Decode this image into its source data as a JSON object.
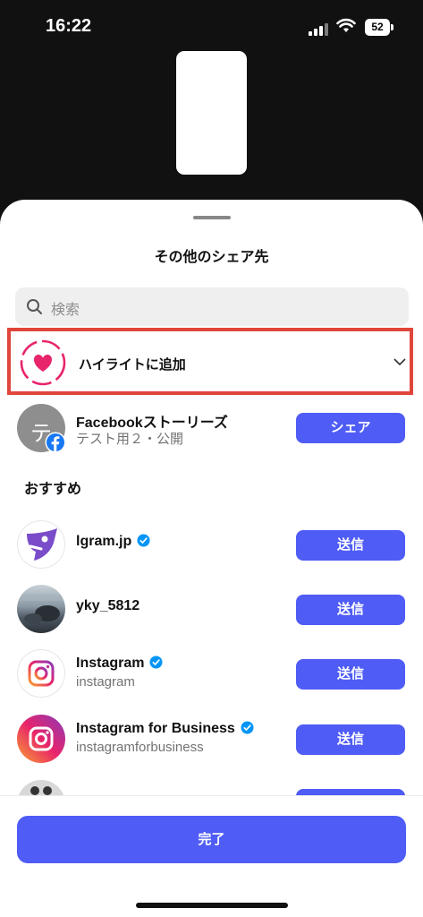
{
  "status": {
    "time": "16:22",
    "battery": "52"
  },
  "sheet": {
    "title": "その他のシェア先",
    "search": {
      "placeholder": "検索"
    },
    "highlight": {
      "label": "ハイライトに追加"
    },
    "facebook": {
      "name": "Facebookストーリーズ",
      "sub": "テスト用２・公開",
      "avatar_char": "テ",
      "button": "シェア"
    },
    "section_title": "おすすめ",
    "recommendations": [
      {
        "name": "lgram.jp",
        "sub": "",
        "verified": true,
        "button": "送信"
      },
      {
        "name": "yky_5812",
        "sub": "",
        "verified": false,
        "button": "送信"
      },
      {
        "name": "Instagram",
        "sub": "instagram",
        "verified": true,
        "button": "送信"
      },
      {
        "name": "Instagram for Business",
        "sub": "instagramforbusiness",
        "verified": true,
        "button": "送信"
      }
    ],
    "done_button": "完了"
  },
  "colors": {
    "accent": "#4f5cf5",
    "highlight_border": "#e0463b",
    "heart": "#e8246b"
  }
}
